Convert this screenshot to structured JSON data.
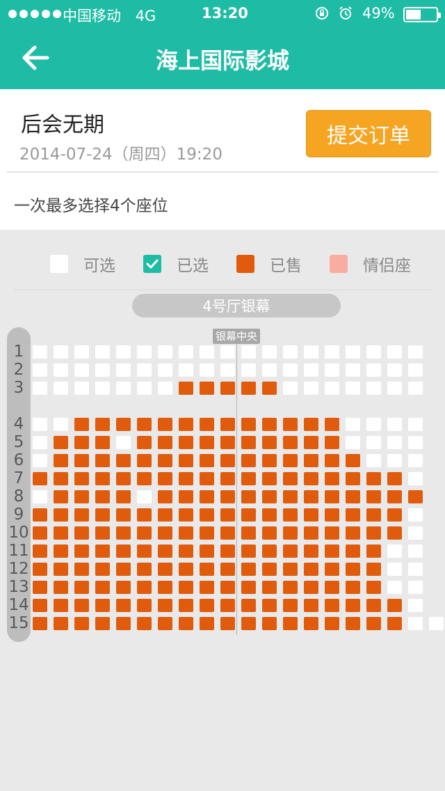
{
  "status_bar": {
    "carrier": "中国移动",
    "network": "4G",
    "time": "13:20",
    "battery": "49%",
    "battery_level": 0.49,
    "icons": [
      "rotation-lock-icon",
      "alarm-icon"
    ]
  },
  "nav": {
    "title": "海上国际影城",
    "back_icon": "arrow-left-icon"
  },
  "movie": {
    "title": "后会无期",
    "showtime": "2014-07-24（周四）19:20",
    "submit_label": "提交订单",
    "limit_note": "一次最多选择4个座位"
  },
  "legend": {
    "available": "可选",
    "selected": "已选",
    "sold": "已售",
    "couple": "情侣座"
  },
  "colors": {
    "teal": "#1fbca5",
    "orange_button": "#f6a523",
    "sold": "#e05c0c",
    "couple": "#f9ada0",
    "available": "#ffffff"
  },
  "hall": {
    "screen_label": "4号厅银幕",
    "center_label": "银幕中央"
  },
  "seat_map": {
    "legend_codes": {
      "A": "available",
      "S": "sold",
      "_": "aisle"
    },
    "rows": [
      {
        "label": "1",
        "seats": "AAAAAAAAAAAAAAAAAAA"
      },
      {
        "label": "2",
        "seats": "AAAAAAAAAAAAAAAAAAA"
      },
      {
        "label": "3",
        "seats": "AAAAAAASSSSSAAAAAAA"
      },
      {
        "label": "4",
        "seats": "AASSSSSSSSSSSSSAAAA"
      },
      {
        "label": "5",
        "seats": "ASSSASSSSSSSSSSAAAA"
      },
      {
        "label": "6",
        "seats": "ASSSSSSSSSSSSSSSAAA"
      },
      {
        "label": "7",
        "seats": "SSSSSSSSSSSSSSSSSSA"
      },
      {
        "label": "8",
        "seats": "ASSSSASSSSSSSSSSSSS"
      },
      {
        "label": "9",
        "seats": "SSSSSSSSSSSSSSSSSSA"
      },
      {
        "label": "10",
        "seats": "SSSSSSSSSSSSSSSSSSA"
      },
      {
        "label": "11",
        "seats": "SSSSSSSSSSSSSSSSSAA"
      },
      {
        "label": "12",
        "seats": "SSSSSSSSSSSSSSSSSAA"
      },
      {
        "label": "13",
        "seats": "SSSSSSSSSSSSSSSSSAA"
      },
      {
        "label": "14",
        "seats": "SSSSSSSSSSSSSSSSSSA"
      },
      {
        "label": "15",
        "seats": "SSSSSSSSSSSSSSSSSSAA"
      }
    ]
  }
}
